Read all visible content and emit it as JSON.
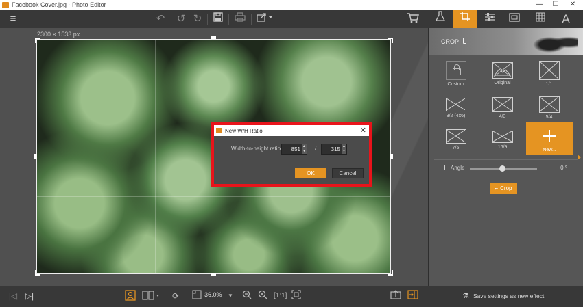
{
  "window": {
    "title": "Facebook Cover.jpg - Photo Editor",
    "controls": {
      "minimize": "—",
      "maximize": "☐",
      "close": "✕"
    }
  },
  "toolbar": {
    "icons": [
      "menu-icon",
      "undo-icon",
      "undo-step-icon",
      "redo-icon",
      "save-icon",
      "print-icon",
      "share-icon",
      "cart-icon"
    ]
  },
  "canvas": {
    "image_size": "2300 × 1533 px"
  },
  "dialog": {
    "title": "New W/H Ratio",
    "label": "Width-to-height ratio",
    "width_value": "851",
    "separator": "/",
    "height_value": "315",
    "ok_label": "OK",
    "cancel_label": "Cancel",
    "close_glyph": "✕"
  },
  "right_tabs": {
    "items": [
      "flask-icon",
      "crop-icon",
      "adjust-icon",
      "frame-icon",
      "texture-icon",
      "text-icon"
    ],
    "active": "crop-icon"
  },
  "crop_panel": {
    "header": "CROP",
    "presets": [
      {
        "label": "Custom"
      },
      {
        "label": "Original"
      },
      {
        "label": "1/1"
      },
      {
        "label": "3/2 (4x6)"
      },
      {
        "label": "4/3"
      },
      {
        "label": "5/4"
      },
      {
        "label": "7/5"
      },
      {
        "label": "16/9"
      },
      {
        "label": "New..."
      }
    ],
    "active_preset": "New...",
    "angle_label": "Angle",
    "angle_value": "0 °",
    "angle_level": 0.5,
    "crop_button": "Crop"
  },
  "bottom": {
    "zoom": "36.0%",
    "save_settings": "Save settings as new effect"
  },
  "colors": {
    "accent": "#e59422",
    "highlight_outline": "#e8141b",
    "panel": "#565656",
    "toolbar": "#383838"
  }
}
